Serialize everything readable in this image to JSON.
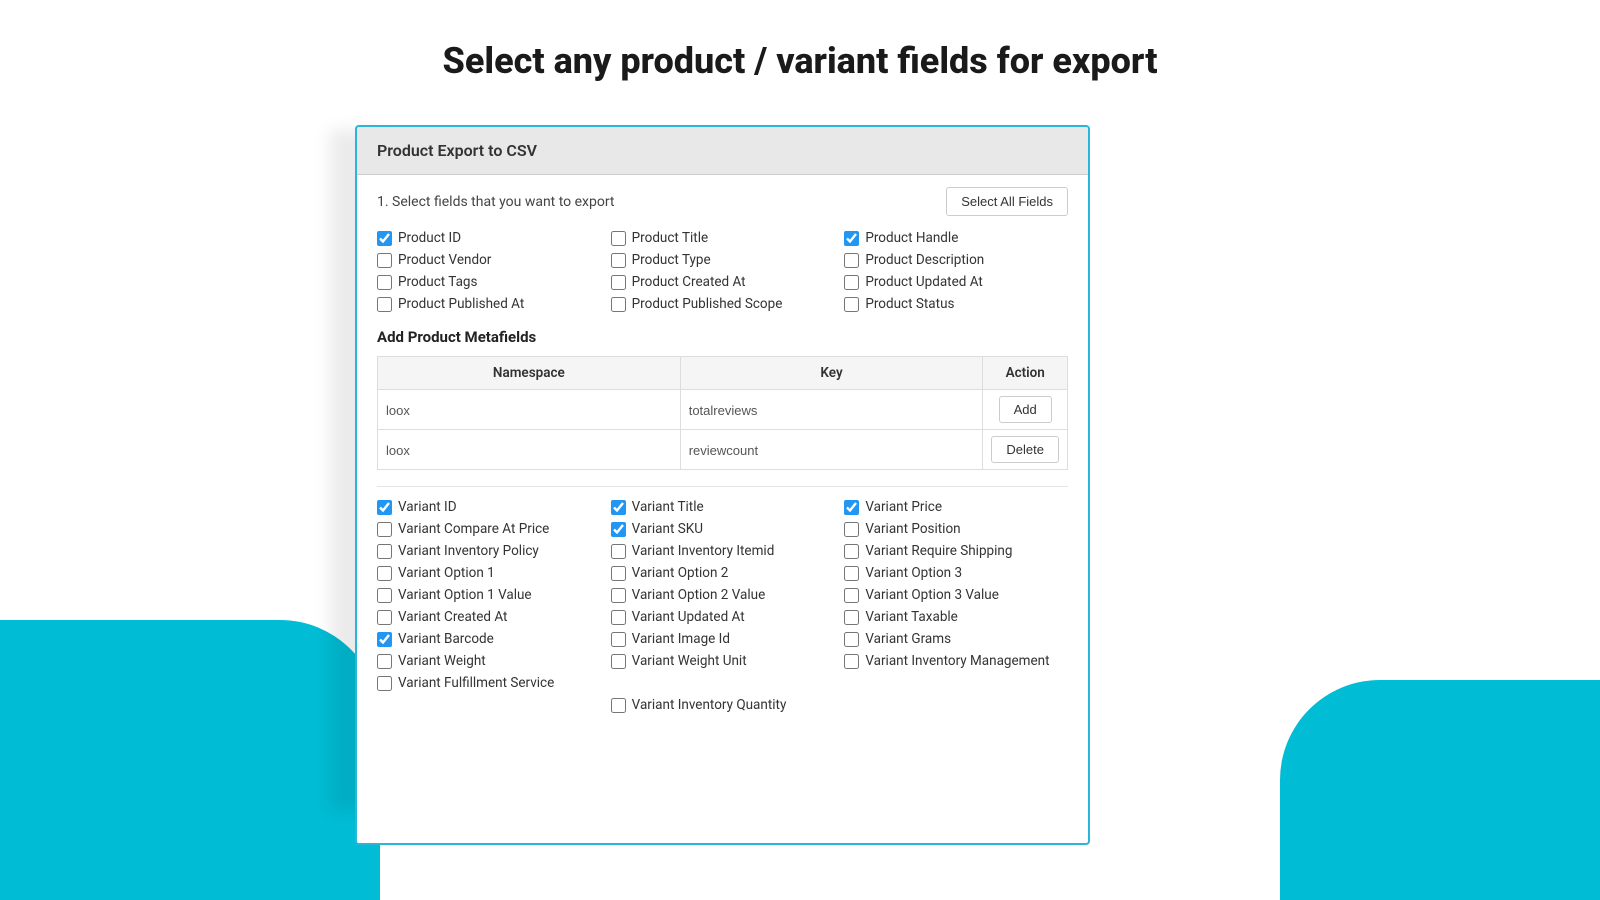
{
  "page": {
    "title": "Select any product / variant fields for export"
  },
  "card": {
    "header": "Product Export to CSV",
    "section_label": "1. Select fields that you want to export",
    "select_all_label": "Select All Fields"
  },
  "product_fields": [
    {
      "id": "product_id",
      "label": "Product ID",
      "checked": true
    },
    {
      "id": "product_title",
      "label": "Product Title",
      "checked": false
    },
    {
      "id": "product_handle",
      "label": "Product Handle",
      "checked": true
    },
    {
      "id": "product_vendor",
      "label": "Product Vendor",
      "checked": false
    },
    {
      "id": "product_type",
      "label": "Product Type",
      "checked": false
    },
    {
      "id": "product_description",
      "label": "Product Description",
      "checked": false
    },
    {
      "id": "product_tags",
      "label": "Product Tags",
      "checked": false
    },
    {
      "id": "product_created_at",
      "label": "Product Created At",
      "checked": false
    },
    {
      "id": "product_updated_at",
      "label": "Product Updated At",
      "checked": false
    },
    {
      "id": "product_published_at",
      "label": "Product Published At",
      "checked": false
    },
    {
      "id": "product_published_scope",
      "label": "Product Published Scope",
      "checked": false
    },
    {
      "id": "product_status",
      "label": "Product Status",
      "checked": false
    }
  ],
  "metafields_section_title": "Add Product Metafields",
  "metafields_columns": [
    "Namespace",
    "Key",
    "Action"
  ],
  "metafields_rows": [
    {
      "namespace": "loox",
      "key": "totalreviews",
      "action": "Add"
    },
    {
      "namespace": "loox",
      "key": "reviewcount",
      "action": "Delete"
    }
  ],
  "variant_fields": [
    {
      "id": "variant_id",
      "label": "Variant ID",
      "checked": true
    },
    {
      "id": "variant_title",
      "label": "Variant Title",
      "checked": true
    },
    {
      "id": "variant_price",
      "label": "Variant Price",
      "checked": true
    },
    {
      "id": "variant_compare_at_price",
      "label": "Variant Compare At Price",
      "checked": false
    },
    {
      "id": "variant_sku",
      "label": "Variant SKU",
      "checked": true
    },
    {
      "id": "variant_position",
      "label": "Variant Position",
      "checked": false
    },
    {
      "id": "variant_inventory_policy",
      "label": "Variant Inventory Policy",
      "checked": false
    },
    {
      "id": "variant_inventory_itemid",
      "label": "Variant Inventory Itemid",
      "checked": false
    },
    {
      "id": "variant_require_shipping",
      "label": "Variant Require Shipping",
      "checked": false
    },
    {
      "id": "variant_option1",
      "label": "Variant Option 1",
      "checked": false
    },
    {
      "id": "variant_option2",
      "label": "Variant Option 2",
      "checked": false
    },
    {
      "id": "variant_option3",
      "label": "Variant Option 3",
      "checked": false
    },
    {
      "id": "variant_option1_value",
      "label": "Variant Option 1 Value",
      "checked": false
    },
    {
      "id": "variant_option2_value",
      "label": "Variant Option 2 Value",
      "checked": false
    },
    {
      "id": "variant_option3_value",
      "label": "Variant Option 3 Value",
      "checked": false
    },
    {
      "id": "variant_created_at",
      "label": "Variant Created At",
      "checked": false
    },
    {
      "id": "variant_updated_at",
      "label": "Variant Updated At",
      "checked": false
    },
    {
      "id": "variant_taxable",
      "label": "Variant Taxable",
      "checked": false
    },
    {
      "id": "variant_barcode",
      "label": "Variant Barcode",
      "checked": true
    },
    {
      "id": "variant_image_id",
      "label": "Variant Image Id",
      "checked": false
    },
    {
      "id": "variant_grams",
      "label": "Variant Grams",
      "checked": false
    },
    {
      "id": "variant_weight",
      "label": "Variant Weight",
      "checked": false
    },
    {
      "id": "variant_weight_unit",
      "label": "Variant Weight Unit",
      "checked": false
    },
    {
      "id": "variant_inventory_management",
      "label": "Variant Inventory Management",
      "checked": false
    },
    {
      "id": "variant_fulfillment_service",
      "label": "Variant Fulfillment Service",
      "checked": false
    },
    {
      "id": "variant_inventory_quantity",
      "label": "Variant Inventory Quantity",
      "checked": false
    }
  ]
}
